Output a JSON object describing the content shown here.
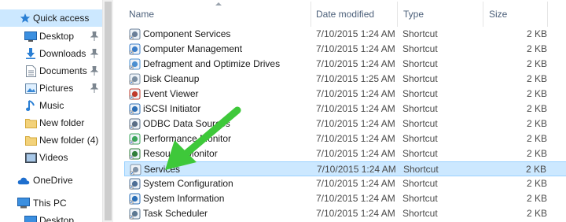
{
  "sidebar": {
    "items": [
      {
        "label": "Quick access",
        "icon": "star-icon",
        "pinned": false,
        "active": true
      },
      {
        "label": "Desktop",
        "icon": "desktop-icon",
        "pinned": true
      },
      {
        "label": "Downloads",
        "icon": "download-icon",
        "pinned": true
      },
      {
        "label": "Documents",
        "icon": "documents-icon",
        "pinned": true
      },
      {
        "label": "Pictures",
        "icon": "pictures-icon",
        "pinned": true
      },
      {
        "label": "Music",
        "icon": "music-icon",
        "pinned": false
      },
      {
        "label": "New folder",
        "icon": "folder-icon",
        "pinned": false
      },
      {
        "label": "New folder (4)",
        "icon": "folder-icon",
        "pinned": false
      },
      {
        "label": "Videos",
        "icon": "videos-icon",
        "pinned": false
      },
      {
        "label": "OneDrive",
        "icon": "cloud-icon",
        "pinned": false
      },
      {
        "label": "This PC",
        "icon": "computer-icon",
        "pinned": false
      },
      {
        "label": "Desktop",
        "icon": "desktop-icon",
        "pinned": false
      }
    ]
  },
  "columns": {
    "name": "Name",
    "date": "Date modified",
    "type": "Type",
    "size": "Size"
  },
  "files": [
    {
      "name": "Component Services",
      "date": "7/10/2015 1:24 AM",
      "type": "Shortcut",
      "size": "2 KB",
      "icon": "component-services-icon"
    },
    {
      "name": "Computer Management",
      "date": "7/10/2015 1:24 AM",
      "type": "Shortcut",
      "size": "2 KB",
      "icon": "computer-management-icon"
    },
    {
      "name": "Defragment and Optimize Drives",
      "date": "7/10/2015 1:24 AM",
      "type": "Shortcut",
      "size": "2 KB",
      "icon": "defragment-icon"
    },
    {
      "name": "Disk Cleanup",
      "date": "7/10/2015 1:25 AM",
      "type": "Shortcut",
      "size": "2 KB",
      "icon": "disk-cleanup-icon"
    },
    {
      "name": "Event Viewer",
      "date": "7/10/2015 1:24 AM",
      "type": "Shortcut",
      "size": "2 KB",
      "icon": "event-viewer-icon"
    },
    {
      "name": "iSCSI Initiator",
      "date": "7/10/2015 1:24 AM",
      "type": "Shortcut",
      "size": "2 KB",
      "icon": "iscsi-icon"
    },
    {
      "name": "ODBC Data Sources",
      "date": "7/10/2015 1:24 AM",
      "type": "Shortcut",
      "size": "2 KB",
      "icon": "odbc-icon"
    },
    {
      "name": "Performance Monitor",
      "date": "7/10/2015 1:24 AM",
      "type": "Shortcut",
      "size": "2 KB",
      "icon": "performance-monitor-icon"
    },
    {
      "name": "Resource Monitor",
      "date": "7/10/2015 1:24 AM",
      "type": "Shortcut",
      "size": "2 KB",
      "icon": "resource-monitor-icon"
    },
    {
      "name": "Services",
      "date": "7/10/2015 1:24 AM",
      "type": "Shortcut",
      "size": "2 KB",
      "icon": "services-icon",
      "selected": true
    },
    {
      "name": "System Configuration",
      "date": "7/10/2015 1:24 AM",
      "type": "Shortcut",
      "size": "2 KB",
      "icon": "system-configuration-icon"
    },
    {
      "name": "System Information",
      "date": "7/10/2015 1:24 AM",
      "type": "Shortcut",
      "size": "2 KB",
      "icon": "system-information-icon"
    },
    {
      "name": "Task Scheduler",
      "date": "7/10/2015 1:24 AM",
      "type": "Shortcut",
      "size": "2 KB",
      "icon": "task-scheduler-icon"
    }
  ],
  "colors": {
    "selection": "#cce8ff",
    "selection_border": "#99d1ff",
    "header_text": "#4c607a",
    "arrow": "#3ec83a"
  }
}
